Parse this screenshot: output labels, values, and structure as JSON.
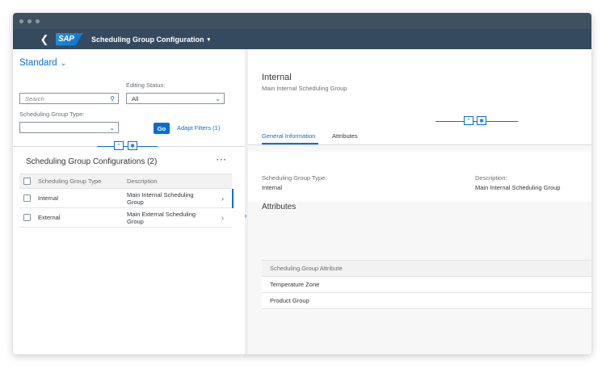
{
  "shell": {
    "back_icon": "chevron-left-icon",
    "logo": "SAP",
    "title": "Scheduling Group Configuration",
    "title_caret": "▾"
  },
  "filter": {
    "variant": "Standard",
    "search_placeholder": "Search",
    "editing_status_label": "Editing Status:",
    "editing_status_value": "All",
    "group_type_label": "Scheduling Group Type:",
    "group_type_value": "",
    "go_label": "Go",
    "adapt_filters_label": "Adapt Filters (1)"
  },
  "list": {
    "heading": "Scheduling Group Configurations (2)",
    "more_label": "···",
    "columns": [
      "Scheduling Group Type",
      "Description"
    ],
    "rows": [
      {
        "type": "Internal",
        "description": "Main Internal Scheduling Group"
      },
      {
        "type": "External",
        "description": "Main External Scheduling Group"
      }
    ]
  },
  "detail": {
    "title": "Internal",
    "subtitle": "Main Internal Scheduling Group",
    "tabs": [
      "General Information",
      "Attributes"
    ],
    "general": {
      "type_label": "Scheduling Group Type:",
      "type_value": "Internal",
      "desc_label": "Description:",
      "desc_value": "Main Internal Scheduling Group"
    },
    "attributes_title": "Attributes",
    "attributes_column": "Scheduling Group Attribute",
    "attributes": [
      "Temperature Zone",
      "Product Group"
    ]
  },
  "colors": {
    "shell": "#354a5f",
    "accent": "#0a6ed1"
  }
}
